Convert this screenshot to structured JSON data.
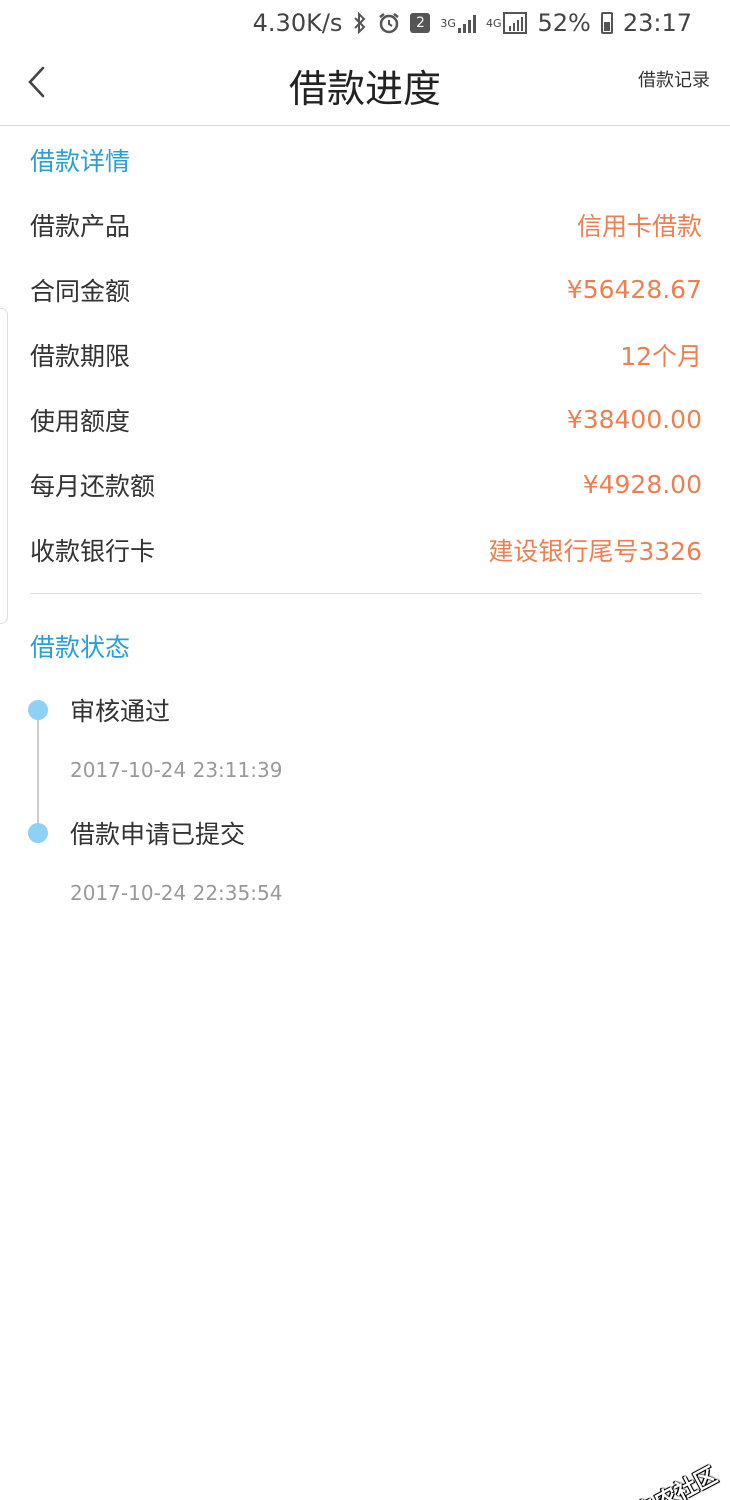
{
  "status_bar": {
    "speed": "4.30K/s",
    "notification_count": "2",
    "network_3g": "3G",
    "network_4g": "4G",
    "battery": "52%",
    "time": "23:17"
  },
  "header": {
    "title": "借款进度",
    "record_link": "借款记录"
  },
  "details": {
    "section_title": "借款详情",
    "rows": [
      {
        "label": "借款产品",
        "value": "信用卡借款"
      },
      {
        "label": "合同金额",
        "value": "¥56428.67"
      },
      {
        "label": "借款期限",
        "value": "12个月"
      },
      {
        "label": "使用额度",
        "value": "¥38400.00"
      },
      {
        "label": "每月还款额",
        "value": "¥4928.00"
      },
      {
        "label": "收款银行卡",
        "value": "建设银行尾号3326"
      }
    ]
  },
  "status": {
    "section_title": "借款状态",
    "events": [
      {
        "title": "审核通过",
        "time": "2017-10-24 23:11:39"
      },
      {
        "title": "借款申请已提交",
        "time": "2017-10-24 22:35:54"
      }
    ]
  },
  "watermark": {
    "text": "卡农社区"
  },
  "colors": {
    "accent_blue": "#2a9fd6",
    "value_orange": "#ee7f50",
    "timeline_dot": "#8fd0f5"
  }
}
